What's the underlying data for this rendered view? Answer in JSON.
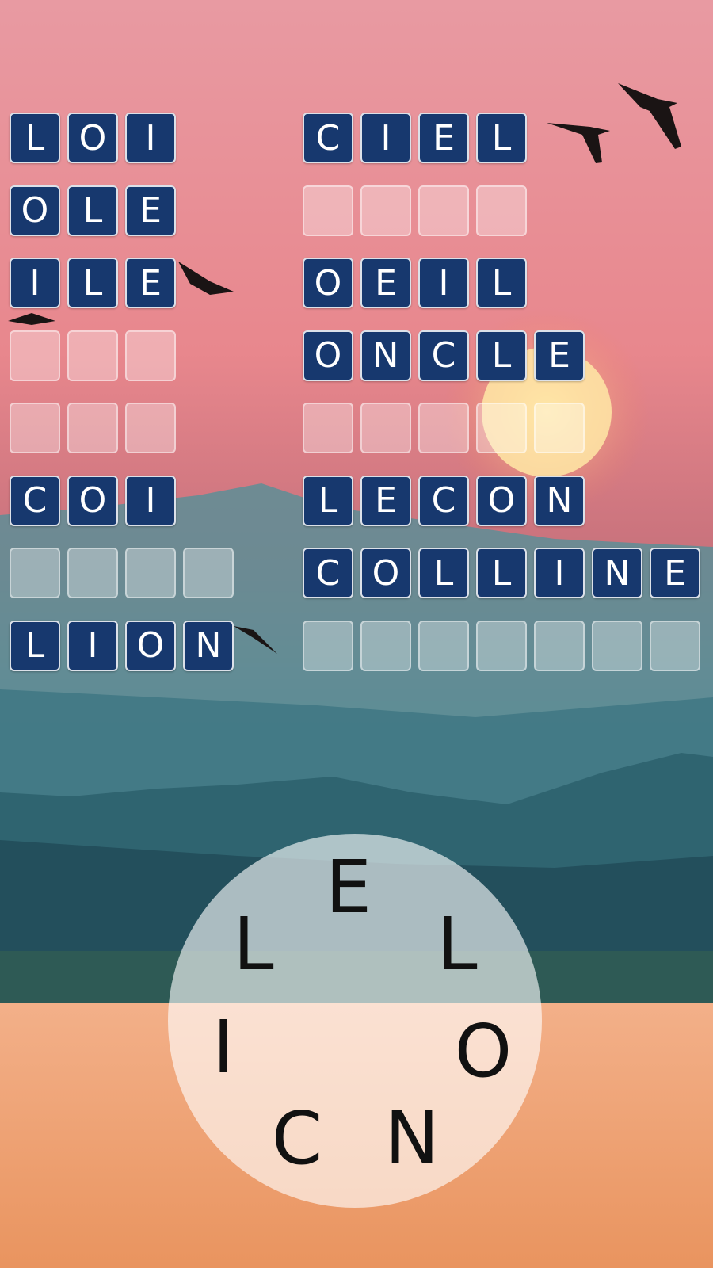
{
  "colors": {
    "tile_filled": "#17386e",
    "tile_text": "#ffffff",
    "sky_top": "#e9939c",
    "water": "#f0a071"
  },
  "left_words": [
    {
      "letters": [
        "L",
        "O",
        "I"
      ],
      "solved": true
    },
    {
      "letters": [
        "O",
        "L",
        "E"
      ],
      "solved": true
    },
    {
      "letters": [
        "I",
        "L",
        "E"
      ],
      "solved": true
    },
    {
      "letters": [
        "",
        "",
        ""
      ],
      "solved": false
    },
    {
      "letters": [
        "",
        "",
        ""
      ],
      "solved": false
    },
    {
      "letters": [
        "C",
        "O",
        "I"
      ],
      "solved": true
    },
    {
      "letters": [
        "",
        "",
        "",
        ""
      ],
      "solved": false
    },
    {
      "letters": [
        "L",
        "I",
        "O",
        "N"
      ],
      "solved": true
    }
  ],
  "right_words": [
    {
      "letters": [
        "C",
        "I",
        "E",
        "L"
      ],
      "solved": true
    },
    {
      "letters": [
        "",
        "",
        "",
        ""
      ],
      "solved": false
    },
    {
      "letters": [
        "O",
        "E",
        "I",
        "L"
      ],
      "solved": true
    },
    {
      "letters": [
        "O",
        "N",
        "C",
        "L",
        "E"
      ],
      "solved": true
    },
    {
      "letters": [
        "",
        "",
        "",
        "",
        ""
      ],
      "solved": false
    },
    {
      "letters": [
        "L",
        "E",
        "C",
        "O",
        "N"
      ],
      "solved": true
    },
    {
      "letters": [
        "C",
        "O",
        "L",
        "L",
        "I",
        "N",
        "E"
      ],
      "solved": true
    },
    {
      "letters": [
        "",
        "",
        "",
        "",
        "",
        "",
        ""
      ],
      "solved": false
    }
  ],
  "wheel_letters": [
    "E",
    "L",
    "O",
    "N",
    "C",
    "I",
    "L"
  ]
}
